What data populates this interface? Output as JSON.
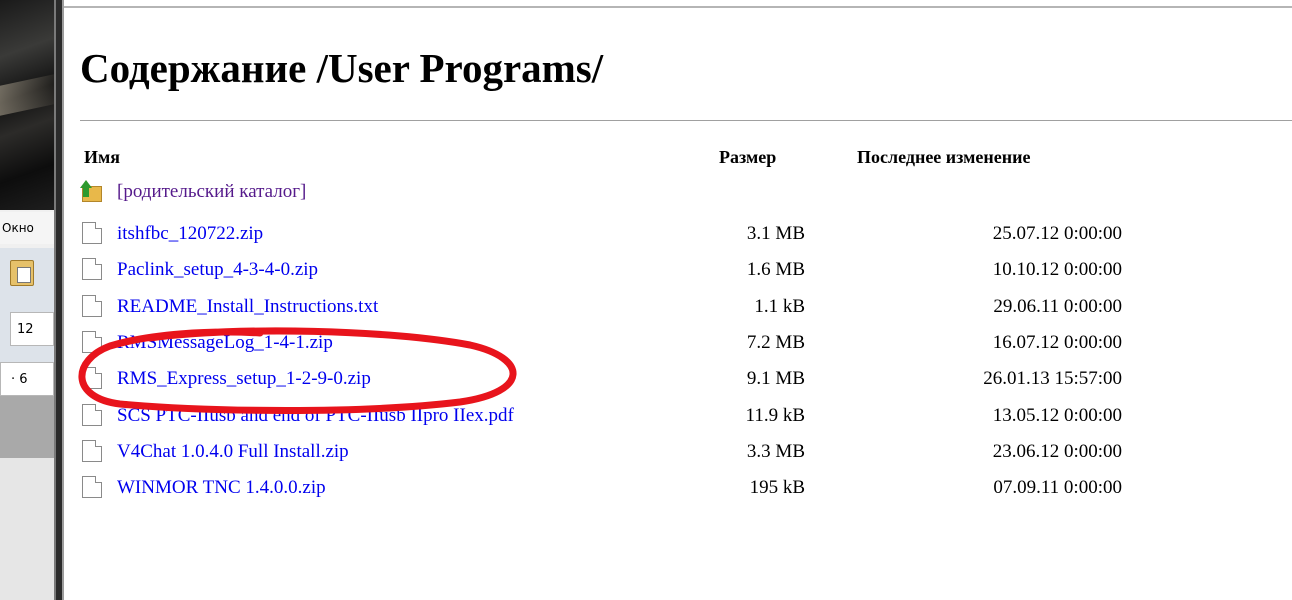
{
  "page": {
    "title": "Содержание /User Programs/"
  },
  "columns": {
    "name": "Имя",
    "size": "Размер",
    "modified": "Последнее изменение"
  },
  "parent_link": "[родительский каталог]",
  "files": [
    {
      "name": "itshfbc_120722.zip",
      "size": "3.1 MB",
      "modified": "25.07.12 0:00:00"
    },
    {
      "name": "Paclink_setup_4-3-4-0.zip",
      "size": "1.6 MB",
      "modified": "10.10.12 0:00:00"
    },
    {
      "name": "README_Install_Instructions.txt",
      "size": "1.1 kB",
      "modified": "29.06.11 0:00:00"
    },
    {
      "name": "RMSMessageLog_1-4-1.zip",
      "size": "7.2 MB",
      "modified": "16.07.12 0:00:00"
    },
    {
      "name": "RMS_Express_setup_1-2-9-0.zip",
      "size": "9.1 MB",
      "modified": "26.01.13 15:57:00"
    },
    {
      "name": "SCS PTC-IIusb and end of PTC-IIusb IIpro IIex.pdf",
      "size": "11.9 kB",
      "modified": "13.05.12 0:00:00"
    },
    {
      "name": "V4Chat 1.0.4.0 Full Install.zip",
      "size": "3.3 MB",
      "modified": "23.06.12 0:00:00"
    },
    {
      "name": "WINMOR TNC 1.4.0.0.zip",
      "size": "195 kB",
      "modified": "07.09.11 0:00:00"
    }
  ],
  "background_window": {
    "menu_label": "Окно",
    "field_value_1": "12",
    "field_value_2": "· 6"
  },
  "annotation": {
    "color": "#e8141c",
    "circled_file": "RMS_Express_setup_1-2-9-0.zip"
  },
  "icons": {
    "parent": "folder-up-arrow-icon",
    "file": "blank-file-icon"
  }
}
